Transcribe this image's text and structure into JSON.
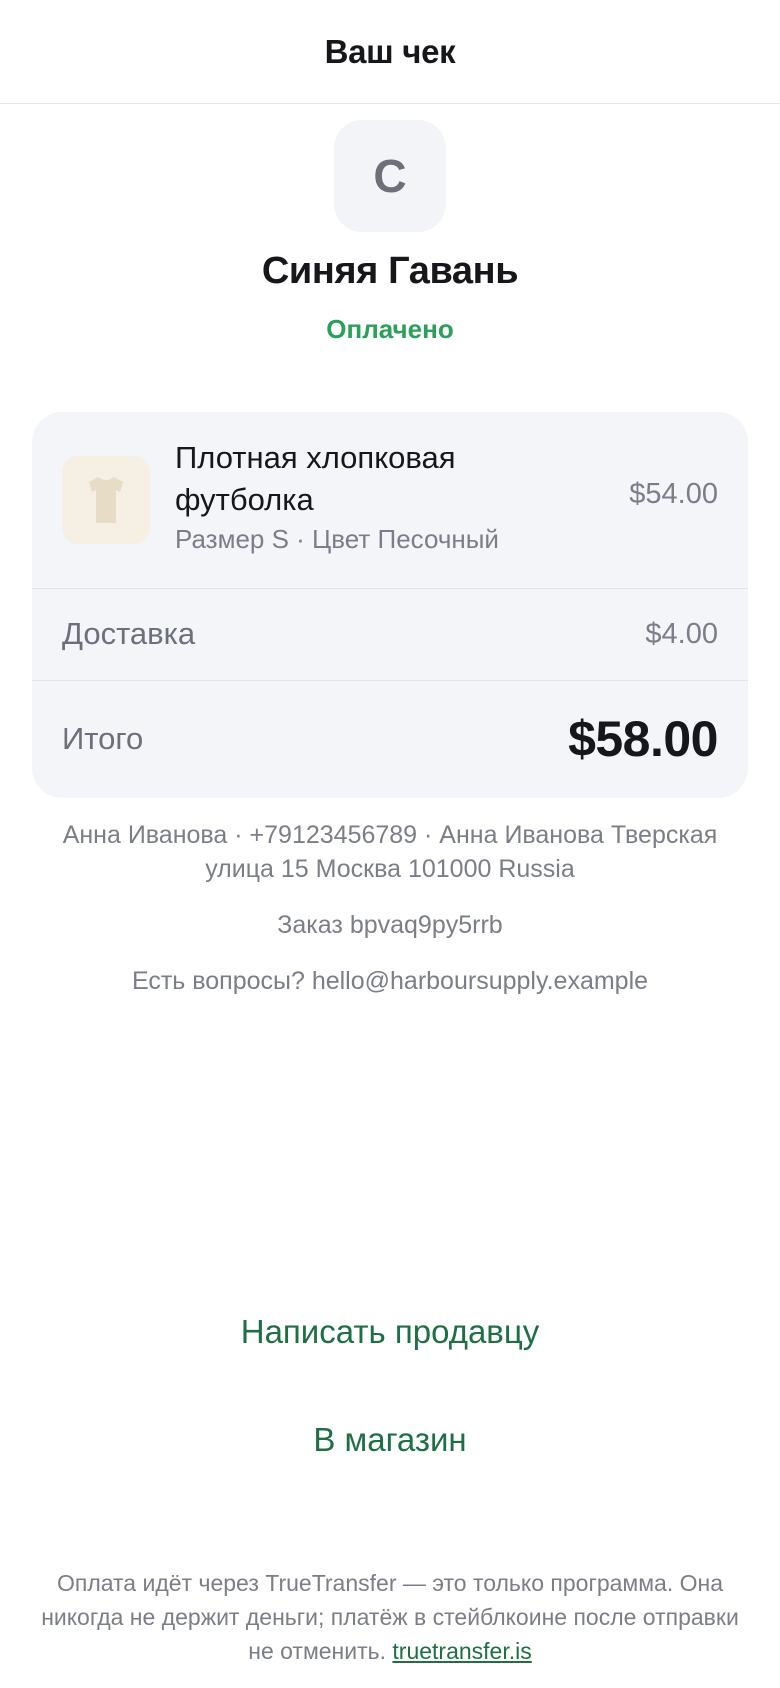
{
  "header": {
    "title": "Ваш чек"
  },
  "merchant": {
    "initial": "С",
    "name": "Синяя Гавань",
    "status": "Оплачено",
    "status_color": "#2aa05a"
  },
  "order": {
    "item": {
      "name": "Плотная хлопковая футболка",
      "meta": "Размер S · Цвет Песочный",
      "price": "$54.00",
      "thumbnail": "tshirt-icon"
    },
    "shipping_label": "Доставка",
    "shipping_value": "$4.00",
    "total_label": "Итого",
    "total_value": "$58.00"
  },
  "details": {
    "address": "Анна Иванова · +79123456789 · Анна Иванова Тверская улица 15 Москва 101000 Russia",
    "order_id": "Заказ bpvaq9py5rrb",
    "contact": "Есть вопросы? hello@harboursupply.example"
  },
  "actions": {
    "message_seller": "Написать продавцу",
    "to_shop": "В магазин",
    "accent_color": "#1f6f45"
  },
  "footer": {
    "text": "Оплата идёт через TrueTransfer — это только программа. Она никогда не держит деньги; платёж в стейблкоине после отправки не отменить.",
    "link_text": "truetransfer.is"
  }
}
